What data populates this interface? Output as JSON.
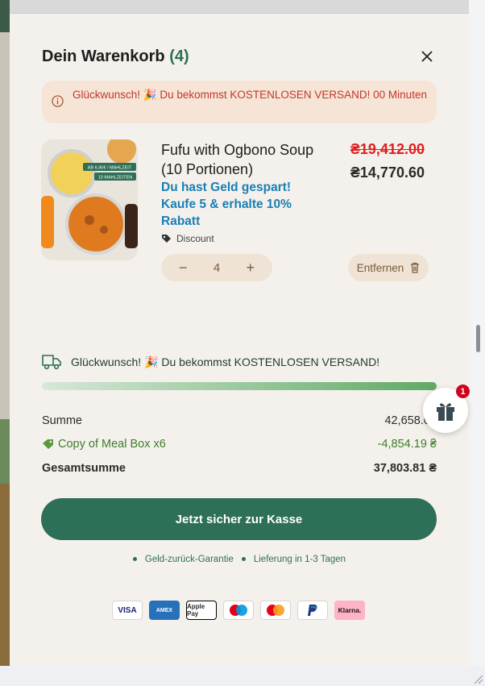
{
  "cart": {
    "title": "Dein Warenkorb",
    "count": "(4)"
  },
  "notice": {
    "text": "Glückwunsch! 🎉 Du bekommst KOSTENLOSEN VERSAND! 00 Minuten"
  },
  "item": {
    "name": "Fufu with Ogbono Soup (10 Portionen)",
    "promo": "Du hast Geld gespart! Kaufe 5 & erhalte 10% Rabatt",
    "tag_label": "Discount",
    "old_price": "₴19,412.00",
    "new_price": "₴14,770.60",
    "quantity": "4",
    "minus": "−",
    "plus": "+",
    "remove_label": "Entfernen",
    "image_labels": [
      "AB 6,90€ / MAHLZEIT",
      "10 MAHLZEITEN"
    ]
  },
  "shipping": {
    "text": "Glückwunsch! 🎉 Du bekommst KOSTENLOSEN VERSAND!",
    "progress_percent": 100
  },
  "totals": {
    "subtotal_label": "Summe",
    "subtotal_value": "42,658.00",
    "discount_label": "Copy of Meal Box x6",
    "discount_value": "-4,854.19 ₴",
    "total_label": "Gesamtsumme",
    "total_value": "37,803.81 ₴"
  },
  "checkout": {
    "label": "Jetzt sicher zur Kasse"
  },
  "guarantees": [
    "Geld-zurück-Garantie",
    "Lieferung in 1-3 Tagen"
  ],
  "payment_methods": [
    "VISA",
    "AMEX",
    "Apple Pay",
    "Maestro",
    "Mastercard",
    "PayPal",
    "Klarna."
  ],
  "gift": {
    "badge": "1"
  },
  "colors": {
    "brand_green": "#2e6f57",
    "promo_blue": "#1a7fb5",
    "alert_red": "#c0392b",
    "drawer_bg": "#f4f1ec"
  }
}
